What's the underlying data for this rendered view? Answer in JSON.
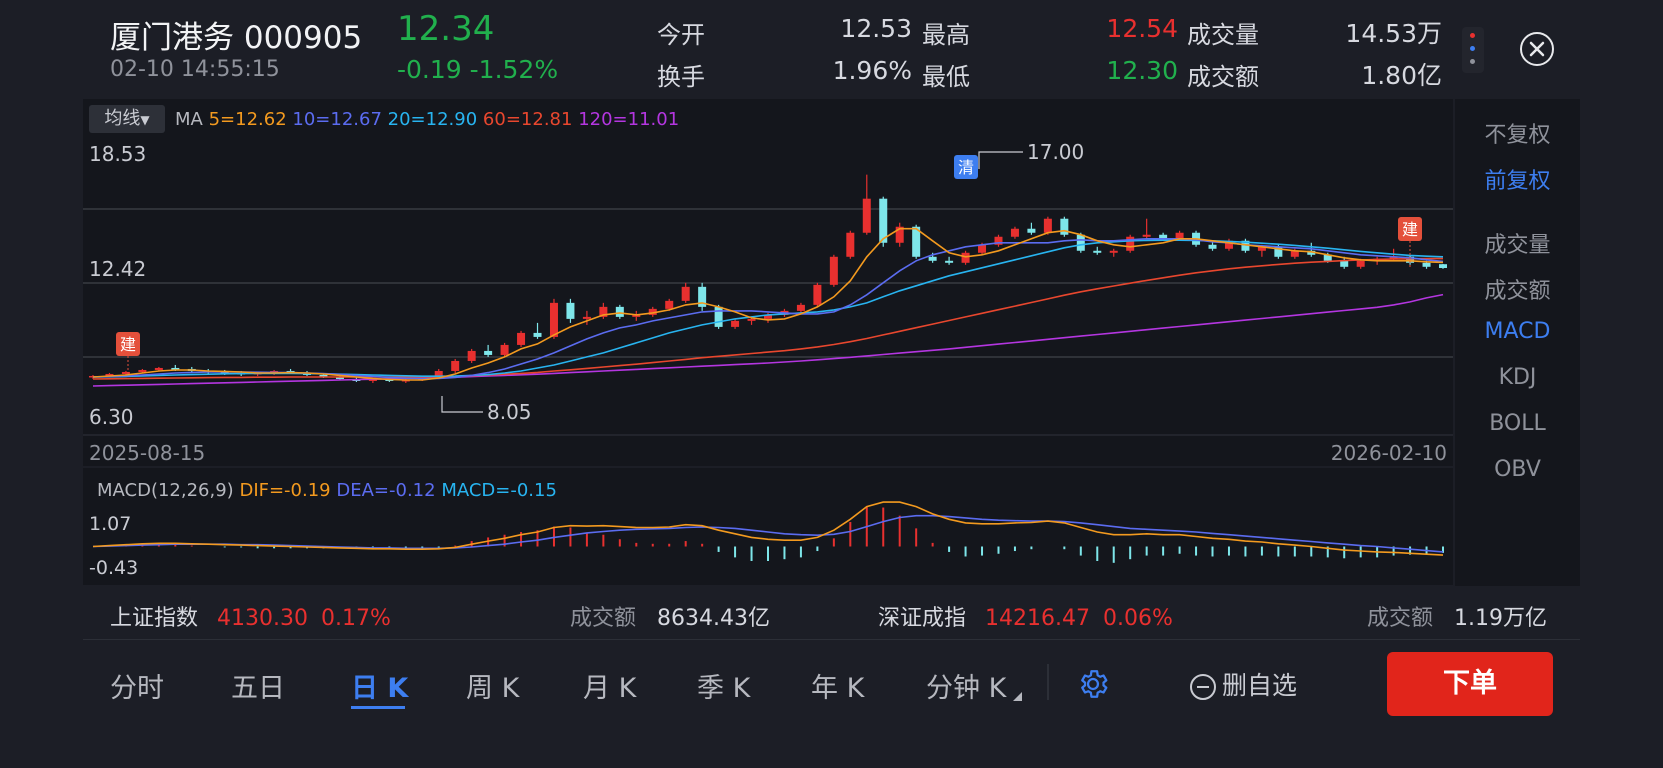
{
  "header": {
    "stock_name": "厦门港务",
    "stock_code": "000905",
    "price": "12.34",
    "datetime": "02-10 14:55:15",
    "change": "-0.19",
    "change_pct": "-1.52%",
    "open_label": "今开",
    "open_value": "12.53",
    "high_label": "最高",
    "high_value": "12.54",
    "volume_label": "成交量",
    "volume_value": "14.53万",
    "turnover_label": "换手",
    "turnover_value": "1.96%",
    "low_label": "最低",
    "low_value": "12.30",
    "amount_label": "成交额",
    "amount_value": "1.80亿"
  },
  "chart": {
    "ma_dropdown": "均线",
    "ma_label": "MA",
    "ma5": "5=12.62",
    "ma10": "10=12.67",
    "ma20": "20=12.90",
    "ma60": "60=12.81",
    "ma120": "120=11.01",
    "y_top": "18.53",
    "y_mid": "12.42",
    "y_bottom": "6.30",
    "max_annot": "17.00",
    "min_annot": "8.05",
    "date_start": "2025-08-15",
    "date_end": "2026-02-10",
    "marker_jian": "建",
    "marker_qing": "清",
    "colors": {
      "ma5": "#f39a1f",
      "ma10": "#5b6cf0",
      "ma20": "#28b4f0",
      "ma60": "#e8472e",
      "ma120": "#b436e0",
      "up": "#e8302f",
      "down": "#7ee6ea"
    },
    "candles": [
      [
        6.9,
        7.0,
        6.8,
        6.95
      ],
      [
        6.95,
        7.1,
        6.9,
        7.05
      ],
      [
        7.05,
        7.2,
        7.0,
        7.15
      ],
      [
        7.15,
        7.3,
        7.1,
        7.25
      ],
      [
        7.25,
        7.4,
        7.2,
        7.35
      ],
      [
        7.35,
        7.5,
        7.2,
        7.3
      ],
      [
        7.3,
        7.4,
        7.1,
        7.2
      ],
      [
        7.2,
        7.3,
        7.05,
        7.15
      ],
      [
        7.15,
        7.25,
        7.0,
        7.1
      ],
      [
        7.1,
        7.2,
        6.95,
        7.05
      ],
      [
        7.05,
        7.15,
        6.95,
        7.1
      ],
      [
        7.1,
        7.25,
        7.0,
        7.2
      ],
      [
        7.2,
        7.3,
        7.05,
        7.1
      ],
      [
        7.1,
        7.2,
        6.95,
        7.0
      ],
      [
        7.0,
        7.1,
        6.85,
        6.9
      ],
      [
        6.9,
        7.0,
        6.75,
        6.8
      ],
      [
        6.8,
        6.9,
        6.65,
        6.7
      ],
      [
        6.7,
        6.85,
        6.6,
        6.8
      ],
      [
        6.8,
        6.9,
        6.65,
        6.7
      ],
      [
        6.7,
        6.8,
        6.6,
        6.75
      ],
      [
        6.75,
        6.9,
        6.7,
        6.85
      ],
      [
        6.85,
        7.3,
        6.8,
        7.2
      ],
      [
        7.2,
        7.8,
        7.1,
        7.7
      ],
      [
        7.7,
        8.3,
        7.6,
        8.2
      ],
      [
        8.2,
        8.5,
        7.9,
        8.0
      ],
      [
        8.0,
        8.6,
        7.9,
        8.5
      ],
      [
        8.5,
        9.2,
        8.4,
        9.1
      ],
      [
        9.1,
        9.6,
        8.8,
        8.9
      ],
      [
        8.9,
        10.8,
        8.8,
        10.6
      ],
      [
        10.6,
        10.8,
        9.6,
        9.8
      ],
      [
        9.8,
        10.2,
        9.5,
        9.9
      ],
      [
        9.9,
        10.6,
        9.8,
        10.4
      ],
      [
        10.4,
        10.5,
        9.8,
        9.9
      ],
      [
        9.9,
        10.2,
        9.7,
        10.0
      ],
      [
        10.0,
        10.4,
        9.9,
        10.3
      ],
      [
        10.3,
        10.8,
        10.2,
        10.7
      ],
      [
        10.7,
        11.6,
        10.6,
        11.4
      ],
      [
        11.4,
        11.6,
        10.2,
        10.4
      ],
      [
        10.4,
        10.5,
        9.3,
        9.4
      ],
      [
        9.4,
        9.8,
        9.3,
        9.7
      ],
      [
        9.7,
        9.9,
        9.5,
        9.8
      ],
      [
        9.8,
        10.1,
        9.6,
        10.0
      ],
      [
        10.0,
        10.3,
        9.9,
        10.2
      ],
      [
        10.2,
        10.6,
        10.1,
        10.5
      ],
      [
        10.5,
        11.6,
        10.4,
        11.5
      ],
      [
        11.5,
        13.0,
        11.4,
        12.9
      ],
      [
        12.9,
        14.2,
        12.8,
        14.1
      ],
      [
        14.1,
        17.0,
        14.0,
        15.8
      ],
      [
        15.8,
        15.9,
        13.4,
        13.6
      ],
      [
        13.6,
        14.6,
        13.4,
        14.4
      ],
      [
        14.4,
        14.5,
        12.8,
        12.9
      ],
      [
        12.9,
        13.1,
        12.6,
        12.7
      ],
      [
        12.7,
        12.9,
        12.5,
        12.6
      ],
      [
        12.6,
        13.2,
        12.5,
        13.1
      ],
      [
        13.1,
        13.6,
        13.0,
        13.5
      ],
      [
        13.5,
        14.0,
        13.4,
        13.9
      ],
      [
        13.9,
        14.4,
        13.8,
        14.3
      ],
      [
        14.3,
        14.6,
        14.0,
        14.1
      ],
      [
        14.1,
        14.9,
        14.0,
        14.8
      ],
      [
        14.8,
        14.9,
        13.9,
        14.0
      ],
      [
        14.0,
        14.1,
        13.1,
        13.2
      ],
      [
        13.2,
        13.4,
        13.0,
        13.1
      ],
      [
        13.1,
        13.3,
        12.9,
        13.2
      ],
      [
        13.2,
        14.0,
        13.1,
        13.9
      ],
      [
        13.9,
        14.8,
        13.8,
        14.0
      ],
      [
        14.0,
        14.1,
        13.7,
        13.8
      ],
      [
        13.8,
        14.2,
        13.7,
        14.1
      ],
      [
        14.1,
        14.2,
        13.4,
        13.5
      ],
      [
        13.5,
        13.7,
        13.2,
        13.3
      ],
      [
        13.3,
        13.8,
        13.2,
        13.7
      ],
      [
        13.7,
        13.8,
        13.1,
        13.2
      ],
      [
        13.2,
        13.5,
        12.9,
        13.4
      ],
      [
        13.4,
        13.5,
        12.8,
        12.9
      ],
      [
        12.9,
        13.3,
        12.8,
        13.2
      ],
      [
        13.2,
        13.6,
        12.9,
        13.0
      ],
      [
        13.0,
        13.1,
        12.6,
        12.7
      ],
      [
        12.7,
        12.9,
        12.3,
        12.4
      ],
      [
        12.4,
        12.8,
        12.3,
        12.7
      ],
      [
        12.7,
        12.9,
        12.5,
        12.8
      ],
      [
        12.8,
        13.3,
        12.7,
        12.9
      ],
      [
        12.9,
        13.0,
        12.5,
        12.6
      ],
      [
        12.6,
        12.7,
        12.3,
        12.4
      ],
      [
        12.53,
        12.54,
        12.3,
        12.34
      ]
    ],
    "ma5_values": [
      6.9,
      6.95,
      7.0,
      7.1,
      7.2,
      7.25,
      7.25,
      7.2,
      7.18,
      7.15,
      7.1,
      7.1,
      7.12,
      7.1,
      7.05,
      6.98,
      6.9,
      6.82,
      6.78,
      6.75,
      6.75,
      6.85,
      7.05,
      7.35,
      7.6,
      7.9,
      8.3,
      8.55,
      9.0,
      9.4,
      9.7,
      10.0,
      10.1,
      10.0,
      10.1,
      10.25,
      10.5,
      10.6,
      10.4,
      10.15,
      9.85,
      9.75,
      9.8,
      10.05,
      10.4,
      10.9,
      11.7,
      12.9,
      13.8,
      14.3,
      14.3,
      13.7,
      13.1,
      12.9,
      13.0,
      13.2,
      13.5,
      13.8,
      14.1,
      14.2,
      14.0,
      13.7,
      13.5,
      13.4,
      13.5,
      13.6,
      13.8,
      13.8,
      13.7,
      13.6,
      13.5,
      13.4,
      13.3,
      13.2,
      13.15,
      13.0,
      12.85,
      12.75,
      12.7,
      12.7,
      12.7,
      12.65,
      12.62
    ],
    "ma10_values": [
      6.9,
      6.92,
      6.96,
      7.0,
      7.05,
      7.1,
      7.13,
      7.15,
      7.15,
      7.15,
      7.14,
      7.13,
      7.12,
      7.1,
      7.07,
      7.03,
      6.98,
      6.93,
      6.88,
      6.84,
      6.82,
      6.83,
      6.88,
      6.98,
      7.12,
      7.3,
      7.55,
      7.8,
      8.1,
      8.45,
      8.8,
      9.1,
      9.35,
      9.5,
      9.7,
      9.85,
      10.0,
      10.15,
      10.2,
      10.2,
      10.2,
      10.15,
      10.1,
      10.05,
      10.05,
      10.15,
      10.5,
      11.0,
      11.6,
      12.2,
      12.7,
      13.0,
      13.2,
      13.4,
      13.5,
      13.6,
      13.6,
      13.6,
      13.6,
      13.7,
      13.75,
      13.7,
      13.7,
      13.75,
      13.8,
      13.8,
      13.8,
      13.75,
      13.65,
      13.6,
      13.5,
      13.45,
      13.4,
      13.35,
      13.3,
      13.2,
      13.1,
      13.0,
      12.95,
      12.9,
      12.85,
      12.75,
      12.67
    ],
    "ma20_values": [
      6.9,
      6.91,
      6.93,
      6.95,
      6.98,
      7.0,
      7.02,
      7.04,
      7.06,
      7.07,
      7.08,
      7.08,
      7.08,
      7.07,
      7.06,
      7.04,
      7.02,
      7.0,
      6.98,
      6.96,
      6.94,
      6.94,
      6.95,
      6.98,
      7.02,
      7.1,
      7.2,
      7.35,
      7.5,
      7.7,
      7.9,
      8.1,
      8.35,
      8.6,
      8.85,
      9.1,
      9.3,
      9.5,
      9.65,
      9.8,
      9.9,
      10.0,
      10.05,
      10.1,
      10.15,
      10.25,
      10.4,
      10.6,
      10.9,
      11.2,
      11.45,
      11.7,
      11.95,
      12.15,
      12.35,
      12.55,
      12.75,
      12.95,
      13.15,
      13.35,
      13.5,
      13.6,
      13.65,
      13.7,
      13.72,
      13.73,
      13.73,
      13.72,
      13.7,
      13.67,
      13.63,
      13.58,
      13.53,
      13.47,
      13.4,
      13.33,
      13.25,
      13.17,
      13.1,
      13.03,
      12.97,
      12.93,
      12.9
    ],
    "ma60_values": [
      6.8,
      6.81,
      6.82,
      6.83,
      6.84,
      6.85,
      6.86,
      6.87,
      6.88,
      6.88,
      6.89,
      6.89,
      6.9,
      6.9,
      6.9,
      6.9,
      6.9,
      6.9,
      6.9,
      6.9,
      6.9,
      6.91,
      6.93,
      6.96,
      7.0,
      7.04,
      7.08,
      7.13,
      7.2,
      7.26,
      7.33,
      7.4,
      7.47,
      7.54,
      7.62,
      7.7,
      7.78,
      7.86,
      7.93,
      8.0,
      8.07,
      8.14,
      8.21,
      8.3,
      8.4,
      8.52,
      8.66,
      8.82,
      9.0,
      9.18,
      9.36,
      9.54,
      9.72,
      9.9,
      10.08,
      10.26,
      10.44,
      10.62,
      10.8,
      10.98,
      11.15,
      11.3,
      11.44,
      11.58,
      11.72,
      11.85,
      11.98,
      12.1,
      12.2,
      12.3,
      12.38,
      12.45,
      12.52,
      12.58,
      12.63,
      12.67,
      12.71,
      12.74,
      12.77,
      12.79,
      12.8,
      12.81,
      12.81
    ],
    "ma120_values": [
      6.45,
      6.47,
      6.49,
      6.51,
      6.53,
      6.55,
      6.57,
      6.59,
      6.61,
      6.63,
      6.65,
      6.67,
      6.69,
      6.71,
      6.73,
      6.75,
      6.77,
      6.79,
      6.81,
      6.83,
      6.85,
      6.87,
      6.89,
      6.92,
      6.95,
      6.98,
      7.01,
      7.04,
      7.08,
      7.12,
      7.16,
      7.2,
      7.24,
      7.28,
      7.32,
      7.36,
      7.4,
      7.44,
      7.48,
      7.52,
      7.56,
      7.6,
      7.65,
      7.7,
      7.76,
      7.82,
      7.88,
      7.95,
      8.02,
      8.09,
      8.16,
      8.23,
      8.3,
      8.38,
      8.46,
      8.54,
      8.62,
      8.7,
      8.78,
      8.86,
      8.94,
      9.02,
      9.1,
      9.18,
      9.26,
      9.34,
      9.42,
      9.5,
      9.58,
      9.66,
      9.74,
      9.82,
      9.9,
      9.98,
      10.06,
      10.14,
      10.22,
      10.3,
      10.38,
      10.5,
      10.65,
      10.85,
      11.01
    ]
  },
  "macd": {
    "title": "MACD(12,26,9)",
    "dif": "DIF=-0.19",
    "dea": "DEA=-0.12",
    "macd": "MACD=-0.15",
    "y_top": "1.07",
    "y_bottom": "-0.43",
    "dif_values": [
      0.0,
      0.02,
      0.04,
      0.06,
      0.07,
      0.07,
      0.06,
      0.05,
      0.04,
      0.03,
      0.02,
      0.01,
      0.0,
      -0.01,
      -0.02,
      -0.03,
      -0.04,
      -0.05,
      -0.05,
      -0.06,
      -0.06,
      -0.05,
      -0.02,
      0.05,
      0.12,
      0.18,
      0.26,
      0.32,
      0.42,
      0.46,
      0.45,
      0.46,
      0.44,
      0.42,
      0.42,
      0.43,
      0.48,
      0.46,
      0.36,
      0.28,
      0.2,
      0.16,
      0.14,
      0.14,
      0.2,
      0.36,
      0.6,
      0.88,
      0.98,
      0.98,
      0.88,
      0.72,
      0.6,
      0.52,
      0.5,
      0.5,
      0.52,
      0.53,
      0.56,
      0.52,
      0.42,
      0.32,
      0.26,
      0.26,
      0.28,
      0.26,
      0.26,
      0.22,
      0.18,
      0.16,
      0.12,
      0.1,
      0.06,
      0.03,
      0.0,
      -0.04,
      -0.08,
      -0.1,
      -0.12,
      -0.13,
      -0.15,
      -0.17,
      -0.19
    ],
    "dea_values": [
      0.0,
      0.01,
      0.02,
      0.03,
      0.04,
      0.05,
      0.05,
      0.05,
      0.05,
      0.04,
      0.04,
      0.03,
      0.02,
      0.01,
      0.0,
      -0.01,
      -0.02,
      -0.03,
      -0.03,
      -0.04,
      -0.04,
      -0.04,
      -0.03,
      -0.01,
      0.02,
      0.05,
      0.1,
      0.14,
      0.2,
      0.25,
      0.3,
      0.33,
      0.36,
      0.38,
      0.39,
      0.4,
      0.42,
      0.43,
      0.42,
      0.4,
      0.36,
      0.32,
      0.28,
      0.26,
      0.25,
      0.27,
      0.33,
      0.44,
      0.55,
      0.64,
      0.68,
      0.68,
      0.66,
      0.63,
      0.6,
      0.58,
      0.57,
      0.56,
      0.56,
      0.55,
      0.52,
      0.48,
      0.44,
      0.4,
      0.38,
      0.36,
      0.34,
      0.32,
      0.29,
      0.26,
      0.23,
      0.2,
      0.17,
      0.14,
      0.11,
      0.08,
      0.05,
      0.02,
      0.0,
      -0.03,
      -0.06,
      -0.09,
      -0.12
    ]
  },
  "sidebar": {
    "items": [
      "不复权",
      "前复权",
      "成交量",
      "成交额",
      "MACD",
      "KDJ",
      "BOLL",
      "OBV"
    ]
  },
  "index_bar": {
    "sh_label": "上证指数",
    "sh_value": "4130.30",
    "sh_pct": "0.17%",
    "sh_amount_label": "成交额",
    "sh_amount": "8634.43亿",
    "sz_label": "深证成指",
    "sz_value": "14216.47",
    "sz_pct": "0.06%",
    "sz_amount_label": "成交额",
    "sz_amount": "1.19万亿"
  },
  "bottom_tabs": {
    "fenshi": "分时",
    "wuri": "五日",
    "rik": "日 K",
    "zhouk": "周 K",
    "yuek": "月 K",
    "jik": "季 K",
    "niank": "年 K",
    "fenzhongk": "分钟 K",
    "remove_watch": "删自选",
    "order": "下单"
  }
}
